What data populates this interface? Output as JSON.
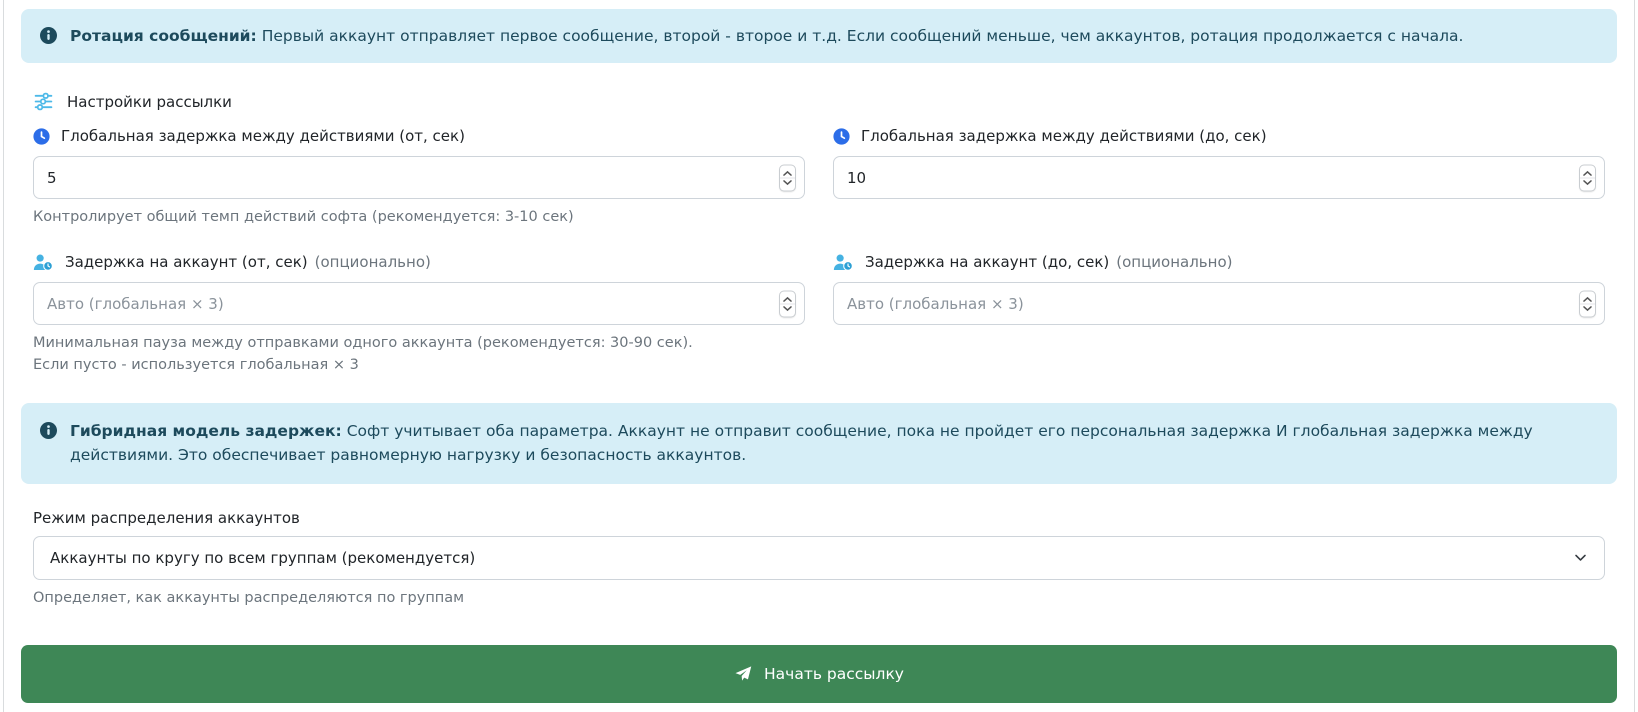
{
  "alerts": {
    "rotation": {
      "title": "Ротация сообщений:",
      "text": "Первый аккаунт отправляет первое сообщение, второй - второе и т.д. Если сообщений меньше, чем аккаунтов, ротация продолжается с начала."
    },
    "hybrid": {
      "title": "Гибридная модель задержек:",
      "text": "Софт учитывает оба параметра. Аккаунт не отправит сообщение, пока не пройдет его персональная задержка И глобальная задержка между действиями. Это обеспечивает равномерную нагрузку и безопасность аккаунтов."
    }
  },
  "section_title": "Настройки рассылки",
  "fields": {
    "global_from": {
      "label": "Глобальная задержка между действиями (от, сек)",
      "value": "5",
      "help": "Контролирует общий темп действий софта (рекомендуется: 3-10 сек)"
    },
    "global_to": {
      "label": "Глобальная задержка между действиями (до, сек)",
      "value": "10"
    },
    "account_from": {
      "label": "Задержка на аккаунт (от, сек)",
      "optional": "(опционально)",
      "placeholder": "Авто (глобальная × 3)",
      "help": "Минимальная пауза между отправками одного аккаунта (рекомендуется: 30-90 сек). Если пусто - используется глобальная × 3"
    },
    "account_to": {
      "label": "Задержка на аккаунт (до, сек)",
      "optional": "(опционально)",
      "placeholder": "Авто (глобальная × 3)"
    }
  },
  "distribution": {
    "label": "Режим распределения аккаунтов",
    "selected_option": "Аккаунты по кругу по всем группам (рекомендуется)",
    "help": "Определяет, как аккаунты распределяются по группам"
  },
  "actions": {
    "start": "Начать рассылку"
  },
  "icons": {
    "alert": "info-circle-icon",
    "section": "sliders-icon",
    "global_delay": "clock-icon",
    "account_delay": "user-clock-icon",
    "select": "chevron-down-icon",
    "start": "paper-plane-icon",
    "number_input": "stepper-up-down-icon"
  },
  "colors": {
    "alert_bg": "#d6eef7",
    "alert_text": "#1d4a5c",
    "accent_blue": "#2c6de8",
    "accent_cyan": "#45b2e2",
    "button_green": "#3e8756",
    "muted_text": "#6c757d",
    "input_border": "#ced4da"
  }
}
